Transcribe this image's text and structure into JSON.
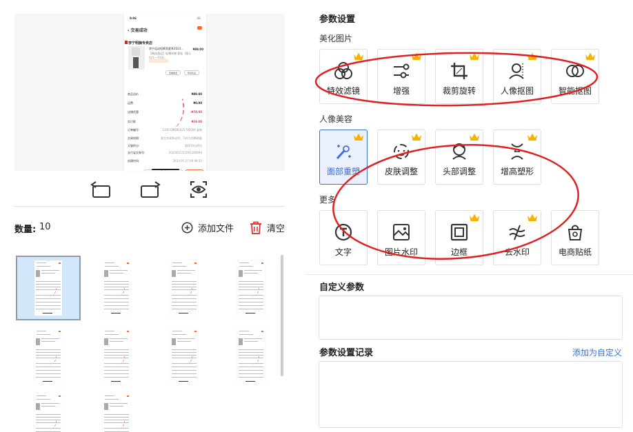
{
  "preview": {
    "status_time": "9:06",
    "status_right": "4G",
    "nav_title": "交易成功",
    "shop_name": "李宁明胸专卖店",
    "product_title": "李宁运动短裤男夏季2023...",
    "product_sub": "【精选速运】轻薄冰感·宽松（图示均大一号XL）",
    "product_price": "¥89.00",
    "btn_1": "查看物流",
    "btn_2": "申请售后",
    "rows": [
      {
        "k": "商品总价",
        "v": "¥89.00",
        "style": "b"
      },
      {
        "k": "运费",
        "v": "¥0.00",
        "style": "b"
      },
      {
        "k": "店铺优惠",
        "v": "-¥70.00",
        "style": "r"
      },
      {
        "k": "实付款",
        "v": "¥19.00",
        "style": "r"
      },
      {
        "k": "订单编号:",
        "v": "2305376886425700008 复制",
        "style": ""
      },
      {
        "k": "交易快照:",
        "v": "发生交易争议时，可作为判断依据",
        "style": ""
      },
      {
        "k": "天猫积分:",
        "v": "获得19点积分",
        "style": ""
      },
      {
        "k": "支付宝交易号:",
        "v": "2023052722001160094",
        "style": ""
      },
      {
        "k": "创建时间:",
        "v": "2023-05-27 08:48:32",
        "style": ""
      }
    ]
  },
  "left_panel": {
    "count_label": "数量:",
    "count_value": "10",
    "add_file": "添加文件",
    "clear": "清空"
  },
  "right_panel": {
    "title": "参数设置",
    "groups": [
      {
        "label": "美化图片",
        "tools": [
          {
            "name": "特效滤镜",
            "icon": "filter-icon",
            "crown": true
          },
          {
            "name": "增强",
            "icon": "enhance-icon",
            "crown": true
          },
          {
            "name": "裁剪旋转",
            "icon": "crop-icon",
            "crown": true
          },
          {
            "name": "人像抠图",
            "icon": "portrait-cutout-icon",
            "crown": true
          },
          {
            "name": "智能抠图",
            "icon": "smart-cutout-icon",
            "crown": true
          }
        ]
      },
      {
        "label": "人像美容",
        "tools": [
          {
            "name": "面部重塑",
            "icon": "magic-wand-icon",
            "crown": true,
            "active": true
          },
          {
            "name": "皮肤调整",
            "icon": "skin-icon",
            "crown": true
          },
          {
            "name": "头部调整",
            "icon": "head-icon",
            "crown": true
          },
          {
            "name": "增高塑形",
            "icon": "body-shape-icon",
            "crown": true
          }
        ]
      },
      {
        "label": "更多",
        "tools": [
          {
            "name": "文字",
            "icon": "text-icon",
            "crown": false
          },
          {
            "name": "图片水印",
            "icon": "image-watermark-icon",
            "crown": false
          },
          {
            "name": "边框",
            "icon": "border-icon",
            "crown": true
          },
          {
            "name": "去水印",
            "icon": "remove-watermark-icon",
            "crown": true
          },
          {
            "name": "电商贴纸",
            "icon": "sticker-icon",
            "crown": false
          }
        ]
      }
    ],
    "custom_params_title": "自定义参数",
    "record_title": "参数设置记录",
    "add_custom_link": "添加为自定义"
  },
  "colors": {
    "accent": "#3a6fd8",
    "crown": "#f5b301",
    "annotation": "#e02020",
    "delete": "#e23b3b"
  }
}
